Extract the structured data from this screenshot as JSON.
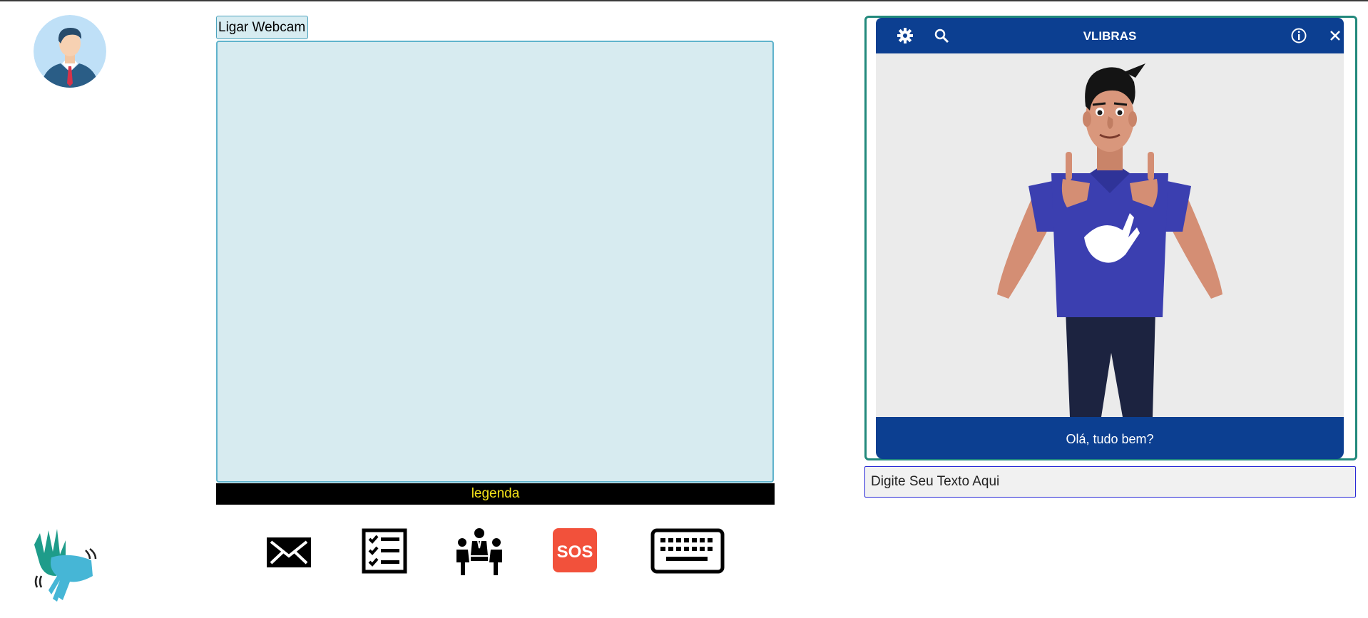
{
  "webcam": {
    "button_label": "Ligar Webcam"
  },
  "caption_bar": {
    "text": "legenda",
    "text_color": "#f2e21a"
  },
  "toolbar": {
    "icons": [
      "mail-icon",
      "checklist-icon",
      "meeting-icon",
      "sos-icon",
      "keyboard-icon"
    ],
    "sos_label": "SOS"
  },
  "vlibras": {
    "title": "VLIBRAS",
    "subtitle": "Olá, tudo bem?",
    "header_icons": [
      "gear-icon",
      "search-icon",
      "info-icon",
      "close-icon"
    ],
    "accent": "#0c3f91",
    "frame_color": "#22897c"
  },
  "input": {
    "placeholder": "Digite Seu Texto Aqui"
  }
}
